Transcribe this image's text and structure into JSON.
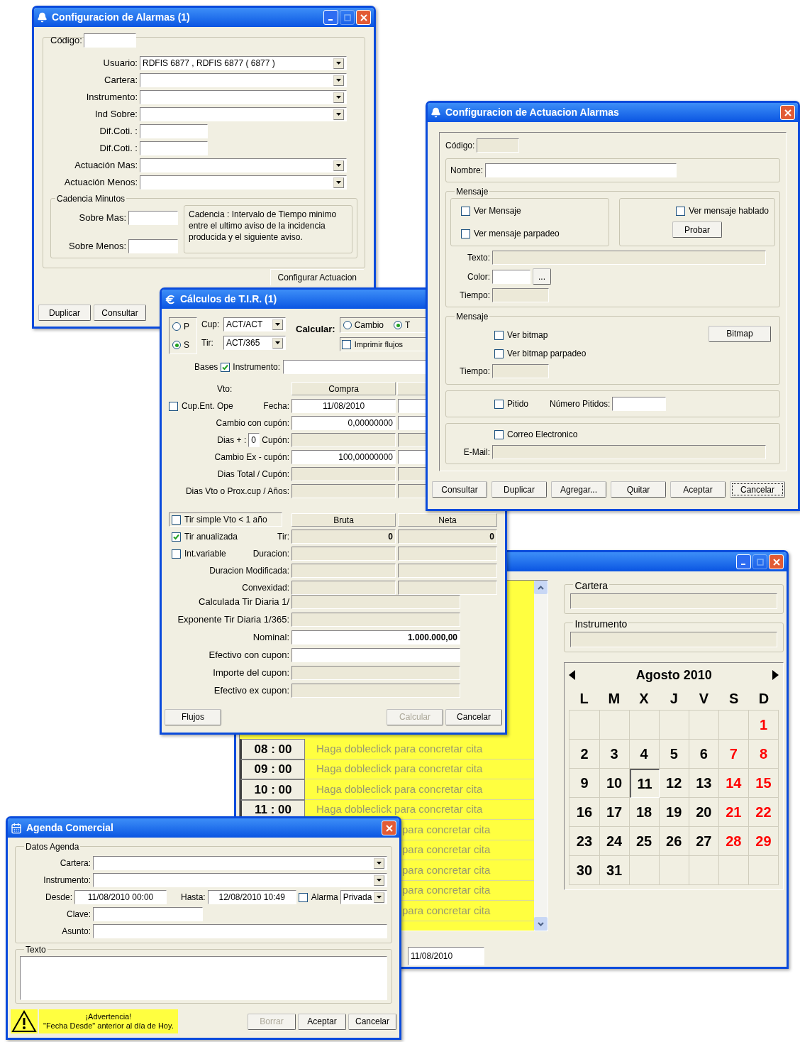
{
  "alarm_config": {
    "title": "Configuracion de Alarmas (1)",
    "title_buttons": [
      {
        "kind": "minimize",
        "disabled": false
      },
      {
        "kind": "maximize",
        "disabled": true
      },
      {
        "kind": "close",
        "disabled": false
      }
    ],
    "fields": [
      {
        "label": "Código:",
        "kind": "short"
      },
      {
        "label": "Usuario:",
        "kind": "dropdown",
        "value": "RDFIS 6877 , RDFIS 6877 ( 6877 )"
      },
      {
        "label": "Cartera:",
        "kind": "dropdown"
      },
      {
        "label": "Instrumento:",
        "kind": "dropdown"
      },
      {
        "label": "Ind Sobre:",
        "kind": "dropdown"
      },
      {
        "label": "Dif.Coti. :",
        "kind": "text"
      },
      {
        "label": "Dif.Coti. :",
        "kind": "text"
      },
      {
        "label": "Actuación Mas:",
        "kind": "dropdown"
      },
      {
        "label": "Actuación Menos:",
        "kind": "dropdown"
      }
    ],
    "cadencia": {
      "title": "Cadencia Minutos",
      "fields": [
        {
          "label": "Sobre Mas:"
        },
        {
          "label": "Sobre Menos:"
        }
      ],
      "note": "Cadencia : Intervalo de Tiempo minimo entre el ultimo aviso de la incidencia producida y el siguiente aviso."
    },
    "tab": "Configurar Actuacion",
    "buttons": [
      "Duplicar",
      "Consultar"
    ]
  },
  "tir_calc": {
    "title": "Cálculos de T.I.R. (1)",
    "base_options": [
      {
        "label": "P",
        "selected": false
      },
      {
        "label": "S",
        "selected": true
      }
    ],
    "cup": {
      "label": "Cup:",
      "value": "ACT/ACT"
    },
    "tir": {
      "label": "Tir:",
      "value": "ACT/365"
    },
    "calcular": {
      "label": "Calcular:",
      "options": [
        {
          "label": "Cambio",
          "selected": false
        },
        {
          "label": "T",
          "selected": true
        }
      ]
    },
    "imprimir": {
      "label": "Imprimir flujos",
      "checked": false
    },
    "bases": {
      "label": "Bases",
      "checked": true
    },
    "instrumento": {
      "label": "Instrumento:"
    },
    "vto_label": "Vto:",
    "compra_header": "Compra",
    "rows_top": [
      {
        "kind": "date",
        "label": "Fecha:",
        "value": "11/08/2010",
        "disabled": false,
        "check": {
          "label": "Cup.Ent. Ope",
          "checked": false
        }
      },
      {
        "kind": "number",
        "label": "Cambio con cupón:",
        "value": "0,00000000",
        "disabled": false
      },
      {
        "kind": "days",
        "label": "Dias + :",
        "days": "0",
        "label2": "Cupón:",
        "disabled": true
      },
      {
        "kind": "number",
        "label": "Cambio Ex - cupón:",
        "value": "100,00000000",
        "disabled": false
      },
      {
        "kind": "number",
        "label": "Dias Total / Cupón:",
        "disabled": true
      },
      {
        "kind": "number",
        "label": "Dias Vto o Prox.cup / Años:",
        "disabled": true
      }
    ],
    "tir_simple": {
      "label": "Tir simple Vto < 1 año",
      "checked": false
    },
    "headers": [
      "Bruta",
      "Neta"
    ],
    "rows_mid": [
      {
        "label": "Tir:",
        "check": {
          "label": "Tir anualizada",
          "checked": true
        },
        "values": [
          "0",
          "0"
        ]
      },
      {
        "label": "Duracion:",
        "check": {
          "label": "Int.variable",
          "checked": false
        }
      },
      {
        "label": "Duracion Modificada:"
      },
      {
        "label": "Convexidad:"
      }
    ],
    "rows_bottom": [
      {
        "label": "Calculada Tir Diaria 1/",
        "disabled": true
      },
      {
        "label": "Exponente Tir Diaria 1/365:",
        "disabled": true
      },
      {
        "label": "Nominal:",
        "value": "1.000.000,00",
        "disabled": false
      },
      {
        "label": "Efectivo con cupon:",
        "disabled": false
      },
      {
        "label": "Importe del cupon:",
        "disabled": true
      },
      {
        "label": "Efectivo ex cupon:",
        "disabled": true
      }
    ],
    "buttons": [
      {
        "label": "Flujos",
        "disabled": false
      },
      {
        "label": "Calcular",
        "disabled": true
      },
      {
        "label": "Cancelar",
        "disabled": false
      }
    ]
  },
  "action_config": {
    "title": "Configuracion de Actuacion Alarmas",
    "title_buttons": [
      {
        "kind": "close",
        "disabled": false
      }
    ],
    "codigo": {
      "label": "Código:"
    },
    "nombre": {
      "label": "Nombre:"
    },
    "mensaje": {
      "title": "Mensaje",
      "checks": [
        {
          "label": "Ver Mensaje",
          "checked": false
        },
        {
          "label": "Ver mensaje parpadeo",
          "checked": false
        }
      ],
      "hablado": {
        "label": "Ver mensaje hablado",
        "checked": false
      },
      "probar": "Probar"
    },
    "texto": {
      "label": "Texto:"
    },
    "color": {
      "label": "Color:",
      "button": "..."
    },
    "tiempo": {
      "label": "Tiempo:"
    },
    "bitmap_group": {
      "title": "Mensaje",
      "checks": [
        {
          "label": "Ver bitmap",
          "checked": false
        },
        {
          "label": "Ver bitmap parpadeo",
          "checked": false
        }
      ],
      "button": "Bitmap",
      "tiempo": {
        "label": "Tiempo:"
      }
    },
    "pitido": {
      "label": "Pitido",
      "checked": false,
      "count_label": "Número Pitidos:"
    },
    "email": {
      "label": "Correo Electronico",
      "checked": false,
      "field_label": "E-Mail:"
    },
    "buttons": [
      {
        "label": "Consultar",
        "focused": false
      },
      {
        "label": "Duplicar",
        "focused": false
      },
      {
        "label": "Agregar...",
        "focused": false
      },
      {
        "label": "Quitar",
        "focused": false
      },
      {
        "label": "Aceptar",
        "focused": false
      },
      {
        "label": "Cancelar",
        "focused": true
      }
    ]
  },
  "calendar_agenda": {
    "title_buttons": [
      {
        "kind": "minimize",
        "disabled": false
      },
      {
        "kind": "maximize",
        "disabled": true
      },
      {
        "kind": "close",
        "disabled": false
      }
    ],
    "rows": [
      {
        "kind": "full",
        "time": "08 : 00",
        "text": "Haga dobleclick para concretar cita"
      },
      {
        "kind": "full",
        "time": "09 : 00",
        "text": "Haga dobleclick para concretar cita"
      },
      {
        "kind": "full",
        "time": "10 : 00",
        "text": "Haga dobleclick para concretar cita"
      },
      {
        "kind": "full",
        "time": "11 : 00",
        "text": "Haga dobleclick para concretar cita"
      },
      {
        "kind": "partial",
        "text": "para concretar cita"
      },
      {
        "kind": "partial",
        "text": "para concretar cita"
      },
      {
        "kind": "partial",
        "text": "para concretar cita"
      },
      {
        "kind": "partial",
        "text": "para concretar cita"
      },
      {
        "kind": "partial",
        "text": "para concretar cita"
      }
    ],
    "cartera": {
      "title": "Cartera"
    },
    "instrumento": {
      "title": "Instrumento"
    },
    "month": "Agosto 2010",
    "weekdays": [
      "L",
      "M",
      "X",
      "J",
      "V",
      "S",
      "D"
    ],
    "weeks": [
      [
        {
          "kind": "blank"
        },
        {
          "kind": "blank"
        },
        {
          "kind": "blank"
        },
        {
          "kind": "blank"
        },
        {
          "kind": "blank"
        },
        {
          "kind": "blank"
        },
        {
          "kind": "day",
          "day": "1",
          "weekend": true,
          "selected": false
        }
      ],
      [
        {
          "kind": "day",
          "day": "2",
          "weekend": false,
          "selected": false
        },
        {
          "kind": "day",
          "day": "3",
          "weekend": false,
          "selected": false
        },
        {
          "kind": "day",
          "day": "4",
          "weekend": false,
          "selected": false
        },
        {
          "kind": "day",
          "day": "5",
          "weekend": false,
          "selected": false
        },
        {
          "kind": "day",
          "day": "6",
          "weekend": false,
          "selected": false
        },
        {
          "kind": "day",
          "day": "7",
          "weekend": true,
          "selected": false
        },
        {
          "kind": "day",
          "day": "8",
          "weekend": true,
          "selected": false
        }
      ],
      [
        {
          "kind": "day",
          "day": "9",
          "weekend": false,
          "selected": false
        },
        {
          "kind": "day",
          "day": "10",
          "weekend": false,
          "selected": false
        },
        {
          "kind": "day",
          "day": "11",
          "weekend": false,
          "selected": true
        },
        {
          "kind": "day",
          "day": "12",
          "weekend": false,
          "selected": false
        },
        {
          "kind": "day",
          "day": "13",
          "weekend": false,
          "selected": false
        },
        {
          "kind": "day",
          "day": "14",
          "weekend": true,
          "selected": false
        },
        {
          "kind": "day",
          "day": "15",
          "weekend": true,
          "selected": false
        }
      ],
      [
        {
          "kind": "day",
          "day": "16",
          "weekend": false,
          "selected": false
        },
        {
          "kind": "day",
          "day": "17",
          "weekend": false,
          "selected": false
        },
        {
          "kind": "day",
          "day": "18",
          "weekend": false,
          "selected": false
        },
        {
          "kind": "day",
          "day": "19",
          "weekend": false,
          "selected": false
        },
        {
          "kind": "day",
          "day": "20",
          "weekend": false,
          "selected": false
        },
        {
          "kind": "day",
          "day": "21",
          "weekend": true,
          "selected": false
        },
        {
          "kind": "day",
          "day": "22",
          "weekend": true,
          "selected": false
        }
      ],
      [
        {
          "kind": "day",
          "day": "23",
          "weekend": false,
          "selected": false
        },
        {
          "kind": "day",
          "day": "24",
          "weekend": false,
          "selected": false
        },
        {
          "kind": "day",
          "day": "25",
          "weekend": false,
          "selected": false
        },
        {
          "kind": "day",
          "day": "26",
          "weekend": false,
          "selected": false
        },
        {
          "kind": "day",
          "day": "27",
          "weekend": false,
          "selected": false
        },
        {
          "kind": "day",
          "day": "28",
          "weekend": true,
          "selected": false
        },
        {
          "kind": "day",
          "day": "29",
          "weekend": true,
          "selected": false
        }
      ],
      [
        {
          "kind": "day",
          "day": "30",
          "weekend": false,
          "selected": false
        },
        {
          "kind": "day",
          "day": "31",
          "weekend": false,
          "selected": false
        },
        {
          "kind": "blank"
        },
        {
          "kind": "blank"
        },
        {
          "kind": "blank"
        },
        {
          "kind": "blank"
        },
        {
          "kind": "blank"
        }
      ]
    ],
    "date": "11/08/2010"
  },
  "agenda_comercial": {
    "title": "Agenda Comercial",
    "title_buttons": [
      {
        "kind": "close",
        "disabled": false
      }
    ],
    "group": "Datos Agenda",
    "cartera": {
      "label": "Cartera:"
    },
    "instrumento": {
      "label": "Instrumento:"
    },
    "desde": {
      "label": "Desde:",
      "value": "11/08/2010 00:00"
    },
    "hasta": {
      "label": "Hasta:",
      "value": "12/08/2010 10:49"
    },
    "alarma": {
      "label": "Alarma",
      "checked": false,
      "value": "Privada"
    },
    "clave": {
      "label": "Clave:"
    },
    "asunto": {
      "label": "Asunto:"
    },
    "texto_group": "Texto",
    "warning": {
      "title": "¡Advertencia!",
      "message": "\"Fecha Desde\" anterior al día de Hoy."
    },
    "buttons": [
      {
        "label": "Borrar",
        "disabled": true
      },
      {
        "label": "Aceptar",
        "disabled": false
      },
      {
        "label": "Cancelar",
        "disabled": false
      }
    ]
  }
}
